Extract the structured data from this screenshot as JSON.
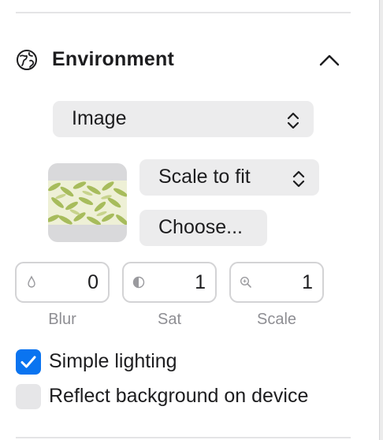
{
  "environment": {
    "title": "Environment",
    "icons": {
      "section": "globe-icon",
      "collapse": "chevron-up-icon"
    },
    "background_type": {
      "selected": "Image"
    },
    "image": {
      "thumbnail": "leaf-pattern-image",
      "scale_mode": {
        "selected": "Scale to fit"
      },
      "choose_label": "Choose..."
    },
    "adjustments": [
      {
        "id": "blur",
        "value": "0",
        "label": "Blur",
        "icon": "droplet-icon"
      },
      {
        "id": "sat",
        "value": "1",
        "label": "Sat",
        "icon": "half-circle-icon"
      },
      {
        "id": "scale",
        "value": "1",
        "label": "Scale",
        "icon": "magnifier-icon"
      }
    ],
    "options": [
      {
        "label": "Simple lighting",
        "checked": true
      },
      {
        "label": "Reflect background on device",
        "checked": false
      }
    ],
    "colors": {
      "accent": "#0a74f0",
      "control_bg": "#ececed",
      "caption": "#8e8e93"
    }
  }
}
